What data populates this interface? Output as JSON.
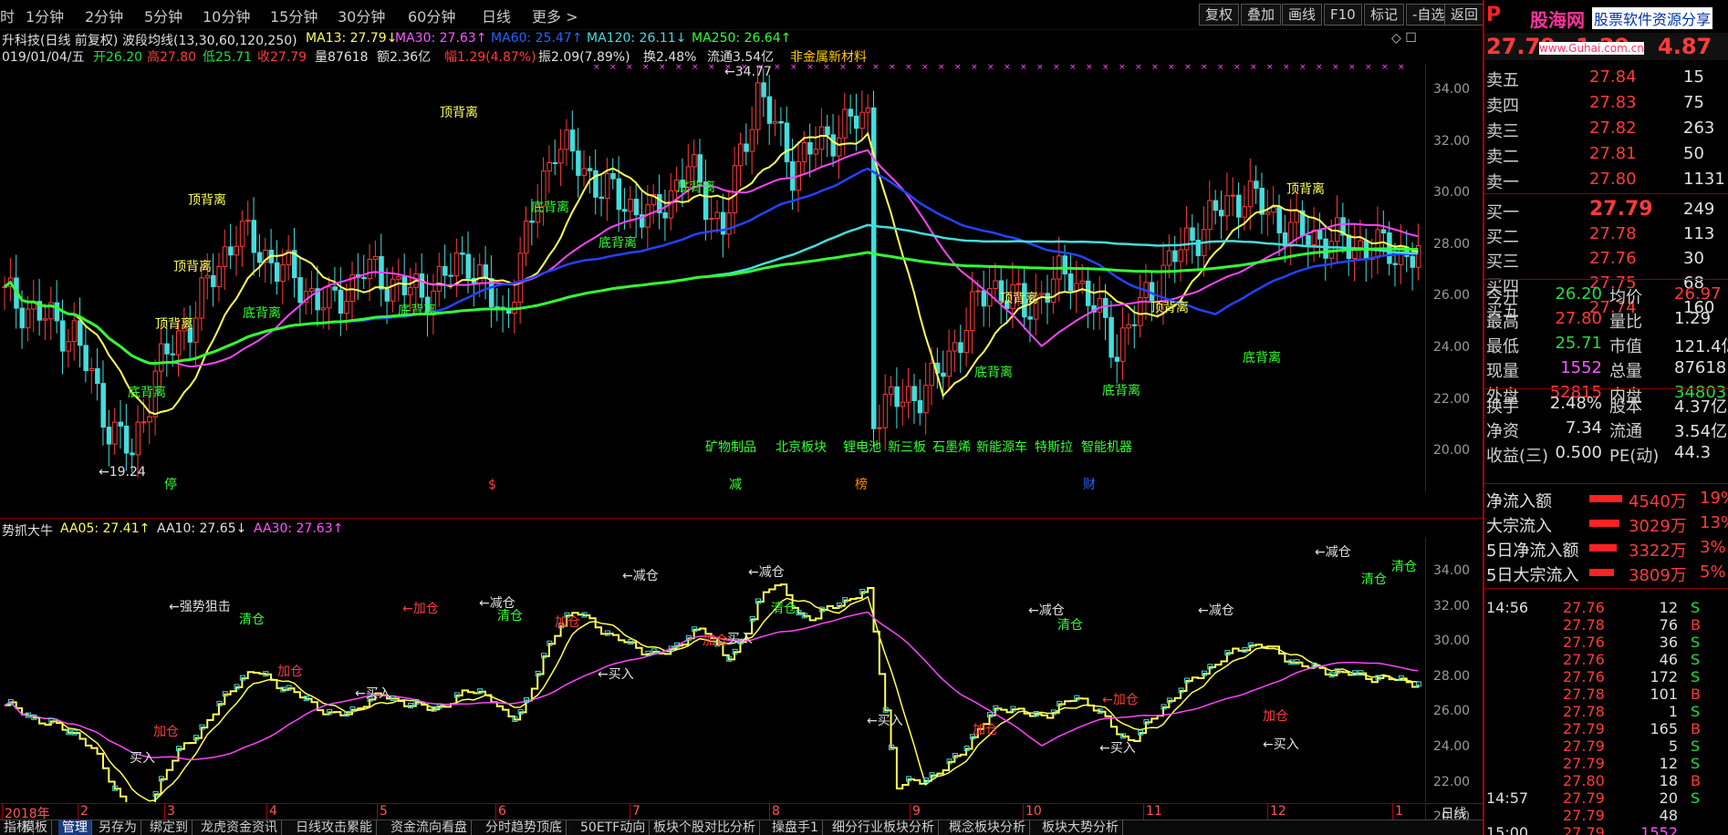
{
  "toolbar": {
    "timeframes": [
      "时",
      "1分钟",
      "2分钟",
      "5分钟",
      "10分钟",
      "15分钟",
      "30分钟",
      "60分钟",
      "日线",
      "更多 >"
    ],
    "buttons": [
      "复权",
      "叠加",
      "画线",
      "F10",
      "标记",
      "-自选",
      "返回"
    ]
  },
  "chart_header": {
    "title": "升科技(日线 前复权)",
    "indicator": "波段均线(13,30,60,120,250)",
    "ma13": "MA13: 27.79↓",
    "ma30": "MA30: 27.63↑",
    "ma60": "MA60: 25.47↑",
    "ma120": "MA120: 26.11↓",
    "ma250": "MA250: 26.64↑",
    "symbols": "◇ ☐"
  },
  "day_info": {
    "date": "019/01/04/五",
    "open": "开26.20",
    "high": "高27.80",
    "low": "低25.71",
    "close": "收27.79",
    "volume": "量87618",
    "amount": "额2.36亿",
    "change": "幅1.29(4.87%)",
    "amplitude": "振2.09(7.89%)",
    "turnover": "换2.48%",
    "float": "流通3.54亿",
    "sector": "非金属新材料"
  },
  "main_axis": [
    "34.00",
    "32.00",
    "30.00",
    "28.00",
    "26.00",
    "24.00",
    "22.00",
    "20.00"
  ],
  "main_annotations": {
    "high_price": "←34.77",
    "low_price": "←19.24",
    "top_divergence": "顶背离",
    "bottom_divergence": "底背离",
    "concepts": [
      "矿物制品",
      "北京板块",
      "锂电池",
      "新三板",
      "石墨烯",
      "新能源车",
      "特斯拉",
      "智能机器"
    ],
    "markers": [
      "停",
      "$",
      "减",
      "榜",
      "财"
    ]
  },
  "sub_header": {
    "name": "势抓大牛",
    "aa05": "AA05: 27.41↑",
    "aa10": "AA10: 27.65↓",
    "aa30": "AA30: 27.63↑"
  },
  "sub_axis": [
    "34.00",
    "32.00",
    "30.00",
    "28.00",
    "26.00",
    "24.00",
    "22.00",
    "20.00"
  ],
  "sub_annotations": {
    "reduce": "←减仓",
    "clear": "清仓",
    "buy": "←买入",
    "add": "加仓",
    "add_arrow": "←加仓",
    "strong": "←强势狙击",
    "buy_plain": "买入"
  },
  "x_axis": {
    "months": [
      "2018年",
      "2",
      "3",
      "4",
      "5",
      "6",
      "7",
      "8",
      "9",
      "10",
      "11",
      "12",
      "1"
    ],
    "period": "日线"
  },
  "bottom_tabs": [
    "指标",
    "模板",
    "管理",
    "另存为",
    "绑定到",
    "龙虎资金资讯",
    "日线攻击累能",
    "资金流向看盘",
    "分时趋势顶底",
    "50ETF动向",
    "板块个股对比分析",
    "操盘手1",
    "细分行业板块分析",
    "概念板块分析",
    "板块大势分析"
  ],
  "right_panel": {
    "logo_p": "P",
    "logo": "股海网",
    "logo_sub": "股票软件资源分享",
    "url": "www.Guhai.com.cn",
    "price": "27.79",
    "change_val": "1.29",
    "change_pct": "4.87",
    "asks": [
      {
        "label": "卖五",
        "price": "27.84",
        "vol": "15"
      },
      {
        "label": "卖四",
        "price": "27.83",
        "vol": "75"
      },
      {
        "label": "卖三",
        "price": "27.82",
        "vol": "263"
      },
      {
        "label": "卖二",
        "price": "27.81",
        "vol": "50"
      },
      {
        "label": "卖一",
        "price": "27.80",
        "vol": "1131"
      }
    ],
    "bids": [
      {
        "label": "买一",
        "price": "27.79",
        "vol": "249"
      },
      {
        "label": "买二",
        "price": "27.78",
        "vol": "113"
      },
      {
        "label": "买三",
        "price": "27.76",
        "vol": "30"
      },
      {
        "label": "买四",
        "price": "27.75",
        "vol": "68"
      },
      {
        "label": "买五",
        "price": "27.74",
        "vol": "160"
      }
    ],
    "stats": [
      {
        "l1": "今开",
        "v1": "26.20",
        "l2": "均价",
        "v2": "26.97"
      },
      {
        "l1": "最高",
        "v1": "27.80",
        "l2": "量比",
        "v2": "1.29"
      },
      {
        "l1": "最低",
        "v1": "25.71",
        "l2": "市值",
        "v2": "121.4亿"
      },
      {
        "l1": "现量",
        "v1": "1552",
        "l2": "总量",
        "v2": "87618"
      },
      {
        "l1": "外盘",
        "v1": "52815",
        "l2": "内盘",
        "v2": "34803"
      }
    ],
    "stats2": [
      {
        "l1": "换手",
        "v1": "2.48%",
        "l2": "股本",
        "v2": "4.37亿"
      },
      {
        "l1": "净资",
        "v1": "7.34",
        "l2": "流通",
        "v2": "3.54亿"
      },
      {
        "l1": "收益(三)",
        "v1": "0.500",
        "l2": "PE(动)",
        "v2": "44.3"
      }
    ],
    "flows": [
      {
        "label": "净流入额",
        "value": "4540万",
        "pct": "19%"
      },
      {
        "label": "大宗流入",
        "value": "3029万",
        "pct": "13%"
      },
      {
        "label": "5日净流入额",
        "value": "3322万",
        "pct": "3%"
      },
      {
        "label": "5日大宗流入",
        "value": "3809万",
        "pct": "5%"
      }
    ],
    "ticks": [
      {
        "time": "14:56",
        "price": "27.76",
        "vol": "12",
        "side": "S"
      },
      {
        "time": "",
        "price": "27.78",
        "vol": "76",
        "side": "B"
      },
      {
        "time": "",
        "price": "27.76",
        "vol": "36",
        "side": "S"
      },
      {
        "time": "",
        "price": "27.76",
        "vol": "46",
        "side": "S"
      },
      {
        "time": "",
        "price": "27.76",
        "vol": "172",
        "side": "S"
      },
      {
        "time": "",
        "price": "27.78",
        "vol": "101",
        "side": "B"
      },
      {
        "time": "",
        "price": "27.78",
        "vol": "1",
        "side": "S"
      },
      {
        "time": "",
        "price": "27.79",
        "vol": "165",
        "side": "B"
      },
      {
        "time": "",
        "price": "27.79",
        "vol": "5",
        "side": "S"
      },
      {
        "time": "",
        "price": "27.79",
        "vol": "12",
        "side": "S"
      },
      {
        "time": "",
        "price": "27.80",
        "vol": "18",
        "side": "B"
      },
      {
        "time": "14:57",
        "price": "27.79",
        "vol": "20",
        "side": "S"
      },
      {
        "time": "",
        "price": "27.79",
        "vol": "48",
        "side": ""
      },
      {
        "time": "15:00",
        "price": "27.79",
        "vol": "1552",
        "side": ""
      }
    ]
  },
  "colors": {
    "up": "#ff3b3b",
    "down": "#44dddd",
    "ma13": "#ffff55",
    "ma30": "#ff44ff",
    "ma60": "#2244ff",
    "ma120": "#44dddd",
    "ma250": "#33ff33"
  }
}
